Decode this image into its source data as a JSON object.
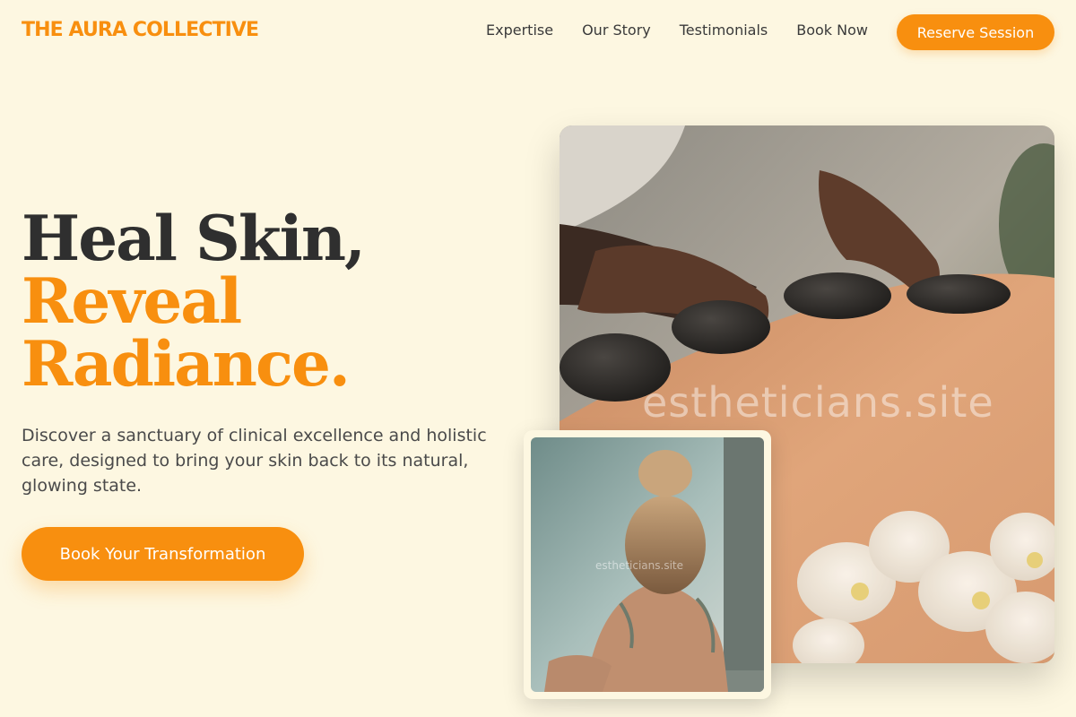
{
  "brand": {
    "name": "THE AURA COLLECTIVE"
  },
  "nav": {
    "links": [
      "Expertise",
      "Our Story",
      "Testimonials",
      "Book Now"
    ],
    "reserve_label": "Reserve Session"
  },
  "hero": {
    "title_line1": "Heal Skin,",
    "title_line2": "Reveal",
    "title_line3": "Radiance.",
    "subtitle": "Discover a sanctuary of clinical excellence and holistic care, designed to bring your skin back to its natural, glowing state.",
    "cta_label": "Book Your Transformation"
  },
  "images": {
    "main_watermark": "estheticians.site",
    "small_watermark": "estheticians.site"
  },
  "colors": {
    "accent": "#f88f0f",
    "background": "#fdf7e1",
    "heading": "#2f2f2f"
  }
}
